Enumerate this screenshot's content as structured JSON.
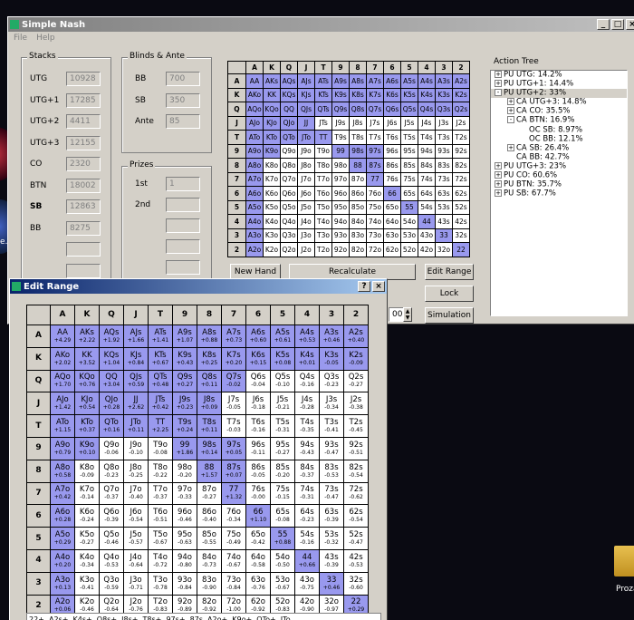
{
  "main_window": {
    "title": "Simple Nash",
    "menu": [
      "File",
      "Help"
    ],
    "stacks_label": "Stacks",
    "stacks": [
      {
        "label": "UTG",
        "value": "10928"
      },
      {
        "label": "UTG+1",
        "value": "17285"
      },
      {
        "label": "UTG+2",
        "value": "4411"
      },
      {
        "label": "UTG+3",
        "value": "12155"
      },
      {
        "label": "CO",
        "value": "2320"
      },
      {
        "label": "BTN",
        "value": "18002"
      },
      {
        "label": "SB",
        "value": "12863"
      },
      {
        "label": "BB",
        "value": "8275"
      }
    ],
    "blinds_label": "Blinds & Ante",
    "blinds": [
      {
        "label": "BB",
        "value": "700"
      },
      {
        "label": "SB",
        "value": "350"
      },
      {
        "label": "Ante",
        "value": "85"
      }
    ],
    "prizes_label": "Prizes",
    "prizes": [
      {
        "label": "1st",
        "value": "1"
      },
      {
        "label": "2nd",
        "value": ""
      }
    ],
    "buttons": {
      "new_hand": "New Hand",
      "recalculate": "Recalculate",
      "edit_range": "Edit Range",
      "lock": "Lock",
      "simulation": "Simulation"
    },
    "spinner_value": "00",
    "action_tree_label": "Action Tree",
    "action_tree": [
      {
        "text": "PU UTG: 14.2%",
        "level": 0,
        "exp": "+"
      },
      {
        "text": "PU UTG+1: 14.4%",
        "level": 0,
        "exp": "+"
      },
      {
        "text": "PU UTG+2: 33%",
        "level": 0,
        "exp": "-"
      },
      {
        "text": "CA UTG+3: 14.8%",
        "level": 1,
        "exp": "+"
      },
      {
        "text": "CA CO: 35.5%",
        "level": 1,
        "exp": "+"
      },
      {
        "text": "CA BTN: 16.9%",
        "level": 1,
        "exp": "-"
      },
      {
        "text": "OC SB: 8.97%",
        "level": 2,
        "exp": ""
      },
      {
        "text": "OC BB: 12.1%",
        "level": 2,
        "exp": ""
      },
      {
        "text": "CA SB: 26.4%",
        "level": 1,
        "exp": "+"
      },
      {
        "text": "CA BB: 42.7%",
        "level": 1,
        "exp": ""
      },
      {
        "text": "PU UTG+3: 23%",
        "level": 0,
        "exp": "+"
      },
      {
        "text": "PU CO: 60.6%",
        "level": 0,
        "exp": "+"
      },
      {
        "text": "PU BTN: 35.7%",
        "level": 0,
        "exp": "+"
      },
      {
        "text": "PU SB: 67.7%",
        "level": 0,
        "exp": "+"
      }
    ]
  },
  "ranks": [
    "A",
    "K",
    "Q",
    "J",
    "T",
    "9",
    "8",
    "7",
    "6",
    "5",
    "4",
    "3",
    "2"
  ],
  "small_selected": [
    [
      1,
      1,
      1,
      1,
      1,
      1,
      1,
      1,
      1,
      1,
      1,
      1,
      1
    ],
    [
      1,
      1,
      1,
      1,
      1,
      1,
      1,
      1,
      1,
      1,
      1,
      1,
      1
    ],
    [
      1,
      1,
      1,
      1,
      1,
      1,
      1,
      1,
      1,
      1,
      1,
      1,
      1
    ],
    [
      1,
      1,
      1,
      1,
      0,
      0,
      0,
      0,
      0,
      0,
      0,
      0,
      0
    ],
    [
      1,
      1,
      1,
      1,
      1,
      0,
      0,
      0,
      0,
      0,
      0,
      0,
      0
    ],
    [
      1,
      1,
      0,
      0,
      0,
      1,
      1,
      1,
      0,
      0,
      0,
      0,
      0
    ],
    [
      1,
      0,
      0,
      0,
      0,
      0,
      1,
      1,
      0,
      0,
      0,
      0,
      0
    ],
    [
      1,
      0,
      0,
      0,
      0,
      0,
      0,
      1,
      0,
      0,
      0,
      0,
      0
    ],
    [
      1,
      0,
      0,
      0,
      0,
      0,
      0,
      0,
      1,
      0,
      0,
      0,
      0
    ],
    [
      1,
      0,
      0,
      0,
      0,
      0,
      0,
      0,
      0,
      1,
      0,
      0,
      0
    ],
    [
      1,
      0,
      0,
      0,
      0,
      0,
      0,
      0,
      0,
      0,
      1,
      0,
      0
    ],
    [
      1,
      0,
      0,
      0,
      0,
      0,
      0,
      0,
      0,
      0,
      0,
      1,
      0
    ],
    [
      1,
      0,
      0,
      0,
      0,
      0,
      0,
      0,
      0,
      0,
      0,
      0,
      1
    ]
  ],
  "edit_range": {
    "title": "Edit Range",
    "bottom_text": "22+, A2s+, K4s+, Q8s+, J8s+, T8s+, 97s+, 87s, A2o+, K9o+, QTo+, JTo",
    "cells": [
      [
        "AA|+4.29",
        "AKs|+2.22",
        "AQs|+1.92",
        "AJs|+1.66",
        "ATs|+1.41",
        "A9s|+1.07",
        "A8s|+0.88",
        "A7s|+0.73",
        "A6s|+0.60",
        "A5s|+0.61",
        "A4s|+0.53",
        "A3s|+0.46",
        "A2s|+0.40"
      ],
      [
        "AKo|+2.02",
        "KK|+3.52",
        "KQs|+1.04",
        "KJs|+0.84",
        "KTs|+0.67",
        "K9s|+0.43",
        "K8s|+0.25",
        "K7s|+0.20",
        "K6s|+0.15",
        "K5s|+0.08",
        "K4s|+0.01",
        "K3s|-0.05",
        "K2s|-0.09"
      ],
      [
        "AQo|+1.70",
        "KQo|+0.76",
        "QQ|+3.04",
        "QJs|+0.59",
        "QTs|+0.48",
        "Q9s|+0.27",
        "Q8s|+0.11",
        "Q7s|-0.02",
        "Q6s|-0.04",
        "Q5s|-0.10",
        "Q4s|-0.16",
        "Q3s|-0.23",
        "Q2s|-0.27"
      ],
      [
        "AJo|+1.42",
        "KJo|+0.54",
        "QJo|+0.28",
        "JJ|+2.62",
        "JTs|+0.42",
        "J9s|+0.23",
        "J8s|+0.09",
        "J7s|-0.05",
        "J6s|-0.18",
        "J5s|-0.21",
        "J4s|-0.28",
        "J3s|-0.34",
        "J2s|-0.38"
      ],
      [
        "ATo|+1.15",
        "KTo|+0.37",
        "QTo|+0.16",
        "JTo|+0.11",
        "TT|+2.25",
        "T9s|+0.24",
        "T8s|+0.11",
        "T7s|-0.03",
        "T6s|-0.16",
        "T5s|-0.31",
        "T4s|-0.35",
        "T3s|-0.41",
        "T2s|-0.45"
      ],
      [
        "A9o|+0.79",
        "K9o|+0.10",
        "Q9o|-0.06",
        "J9o|-0.10",
        "T9o|-0.08",
        "99|+1.86",
        "98s|+0.14",
        "97s|+0.05",
        "96s|-0.11",
        "95s|-0.27",
        "94s|-0.43",
        "93s|-0.47",
        "92s|-0.51"
      ],
      [
        "A8o|+0.58",
        "K8o|-0.09",
        "Q8o|-0.23",
        "J8o|-0.25",
        "T8o|-0.22",
        "98o|-0.20",
        "88|+1.57",
        "87s|+0.07",
        "86s|-0.05",
        "85s|-0.20",
        "84s|-0.37",
        "83s|-0.53",
        "82s|-0.54"
      ],
      [
        "A7o|+0.42",
        "K7o|-0.14",
        "Q7o|-0.37",
        "J7o|-0.40",
        "T7o|-0.37",
        "97o|-0.33",
        "87o|-0.27",
        "77|+1.32",
        "76s|-0.00",
        "75s|-0.15",
        "74s|-0.31",
        "73s|-0.47",
        "72s|-0.62"
      ],
      [
        "A6o|+0.28",
        "K6o|-0.24",
        "Q6o|-0.39",
        "J6o|-0.54",
        "T6o|-0.51",
        "96o|-0.46",
        "86o|-0.40",
        "76o|-0.34",
        "66|+1.10",
        "65s|-0.08",
        "64s|-0.23",
        "63s|-0.39",
        "62s|-0.54"
      ],
      [
        "A5o|+0.29",
        "K5o|-0.27",
        "Q5o|-0.46",
        "J5o|-0.57",
        "T5o|-0.67",
        "95o|-0.63",
        "85o|-0.55",
        "75o|-0.49",
        "65o|-0.42",
        "55|+0.88",
        "54s|-0.16",
        "53s|-0.32",
        "52s|-0.47"
      ],
      [
        "A4o|+0.20",
        "K4o|-0.34",
        "Q4o|-0.53",
        "J4o|-0.64",
        "T4o|-0.72",
        "94o|-0.80",
        "84o|-0.73",
        "74o|-0.67",
        "64o|-0.58",
        "54o|-0.50",
        "44|+0.66",
        "43s|-0.39",
        "42s|-0.53"
      ],
      [
        "A3o|+0.13",
        "K3o|-0.41",
        "Q3o|-0.59",
        "J3o|-0.71",
        "T3o|-0.78",
        "93o|-0.84",
        "83o|-0.90",
        "73o|-0.84",
        "63o|-0.76",
        "53o|-0.67",
        "43o|-0.75",
        "33|+0.46",
        "32s|-0.60"
      ],
      [
        "A2o|+0.06",
        "K2o|-0.46",
        "Q2o|-0.64",
        "J2o|-0.76",
        "T2o|-0.83",
        "92o|-0.89",
        "82o|-0.92",
        "72o|-1.00",
        "62o|-0.92",
        "52o|-0.83",
        "42o|-0.90",
        "32o|-0.97",
        "22|+0.29"
      ]
    ],
    "selected": [
      [
        1,
        1,
        1,
        1,
        1,
        1,
        1,
        1,
        1,
        1,
        1,
        1,
        1
      ],
      [
        1,
        1,
        1,
        1,
        1,
        1,
        1,
        1,
        1,
        1,
        1,
        1,
        1
      ],
      [
        1,
        1,
        1,
        1,
        1,
        1,
        1,
        1,
        0,
        0,
        0,
        0,
        0
      ],
      [
        1,
        1,
        1,
        1,
        1,
        1,
        1,
        0,
        0,
        0,
        0,
        0,
        0
      ],
      [
        1,
        1,
        1,
        1,
        1,
        1,
        1,
        0,
        0,
        0,
        0,
        0,
        0
      ],
      [
        1,
        1,
        0,
        0,
        0,
        1,
        1,
        1,
        0,
        0,
        0,
        0,
        0
      ],
      [
        1,
        0,
        0,
        0,
        0,
        0,
        1,
        1,
        0,
        0,
        0,
        0,
        0
      ],
      [
        1,
        0,
        0,
        0,
        0,
        0,
        0,
        1,
        0,
        0,
        0,
        0,
        0
      ],
      [
        1,
        0,
        0,
        0,
        0,
        0,
        0,
        0,
        1,
        0,
        0,
        0,
        0
      ],
      [
        1,
        0,
        0,
        0,
        0,
        0,
        0,
        0,
        0,
        1,
        0,
        0,
        0
      ],
      [
        1,
        0,
        0,
        0,
        0,
        0,
        0,
        0,
        0,
        0,
        1,
        0,
        0
      ],
      [
        1,
        0,
        0,
        0,
        0,
        0,
        0,
        0,
        0,
        0,
        0,
        1,
        0
      ],
      [
        1,
        0,
        0,
        0,
        0,
        0,
        0,
        0,
        0,
        0,
        0,
        0,
        1
      ]
    ]
  },
  "desktop_icon_label": "Proza",
  "desktop_left_label": "e."
}
